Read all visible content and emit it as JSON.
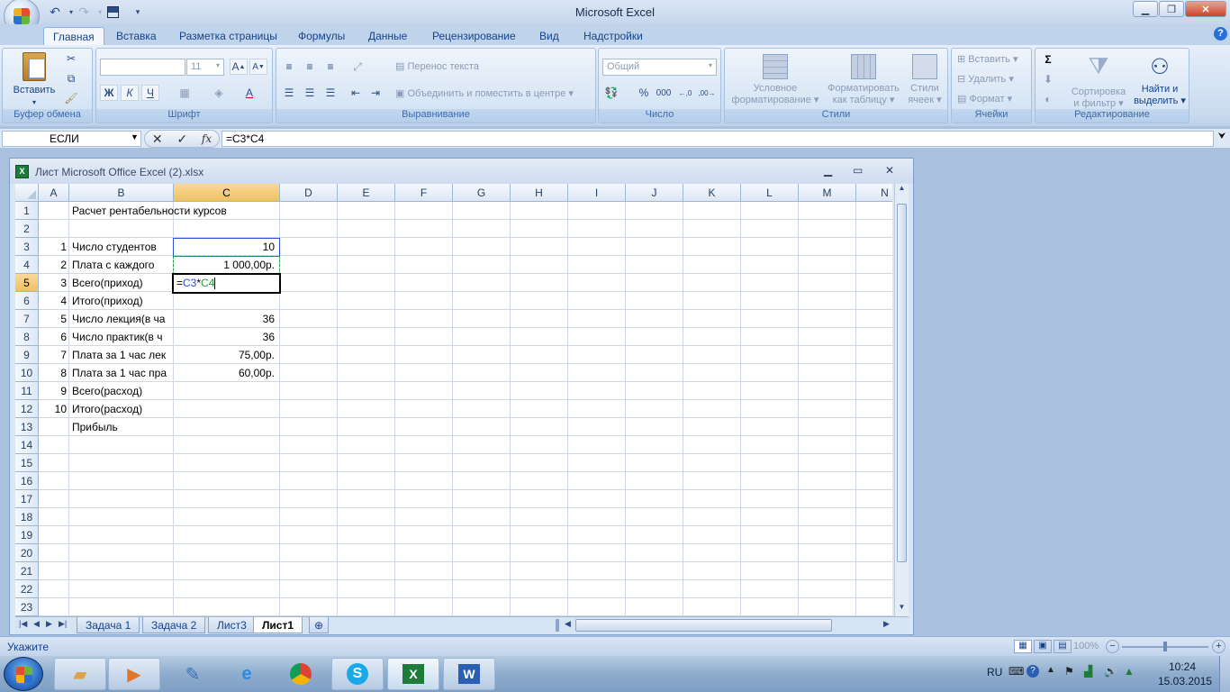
{
  "app": {
    "title": "Microsoft Excel"
  },
  "qat": {
    "save_icon": "save-icon",
    "undo_icon": "undo-icon",
    "redo_icon": "redo-icon"
  },
  "tabs": [
    {
      "label": "Главная",
      "active": true
    },
    {
      "label": "Вставка"
    },
    {
      "label": "Разметка страницы"
    },
    {
      "label": "Формулы"
    },
    {
      "label": "Данные"
    },
    {
      "label": "Рецензирование"
    },
    {
      "label": "Вид"
    },
    {
      "label": "Надстройки"
    }
  ],
  "ribbon": {
    "clipboard": {
      "label": "Буфер обмена",
      "paste": "Вставить"
    },
    "font": {
      "label": "Шрифт",
      "font_size": "11",
      "bold": "Ж",
      "italic": "К",
      "underline": "Ч"
    },
    "alignment": {
      "label": "Выравнивание",
      "wrap": "Перенос текста",
      "merge": "Объединить и поместить в центре"
    },
    "number": {
      "label": "Число",
      "format": "Общий",
      "percent": "%",
      "thousands": "000"
    },
    "styles": {
      "label": "Стили",
      "conditional1": "Условное",
      "conditional2": "форматирование",
      "table1": "Форматировать",
      "table2": "как таблицу",
      "cell1": "Стили",
      "cell2": "ячеек"
    },
    "cells": {
      "label": "Ячейки",
      "insert": "Вставить",
      "delete": "Удалить",
      "format": "Формат"
    },
    "editing": {
      "label": "Редактирование",
      "sort1": "Сортировка",
      "sort2": "и фильтр",
      "find1": "Найти и",
      "find2": "выделить"
    }
  },
  "formula_bar": {
    "name_box": "ЕСЛИ",
    "fx": "fx",
    "formula": "=C3*C4"
  },
  "workbook": {
    "title": "Лист Microsoft Office Excel (2).xlsx",
    "columns": [
      "A",
      "B",
      "C",
      "D",
      "E",
      "F",
      "G",
      "H",
      "I",
      "J",
      "K",
      "L",
      "M",
      "N"
    ],
    "rows": [
      "1",
      "2",
      "3",
      "4",
      "5",
      "6",
      "7",
      "8",
      "9",
      "10",
      "11",
      "12",
      "13",
      "14",
      "15",
      "16",
      "17",
      "18",
      "19",
      "20",
      "21",
      "22",
      "23"
    ],
    "cells": {
      "B1": "Расчет рентабельности курсов",
      "A3": "1",
      "B3": "Число студентов",
      "C3": "10",
      "A4": "2",
      "B4": "Плата с каждого",
      "C4": "1 000,00р.",
      "A5": "3",
      "B5": "Всего(приход)",
      "A6": "4",
      "B6": "Итого(приход)",
      "A7": "5",
      "B7": "Число лекция(в ча",
      "C7": "36",
      "A8": "6",
      "B8": "Число практик(в ч",
      "C8": "36",
      "A9": "7",
      "B9": "Плата за 1 час лек",
      "C9": "75,00р.",
      "A10": "8",
      "B10": "Плата за 1 час пра",
      "C10": "60,00р.",
      "A11": "9",
      "B11": "Всего(расход)",
      "A12": "10",
      "B12": "Итого(расход)",
      "B13": "Прибыль"
    },
    "edit_cell": {
      "eq": "=",
      "ref1": "C3",
      "op": "*",
      "ref2": "C4"
    },
    "sheets": [
      "Задача 1",
      "Задача 2",
      "Лист3",
      "Лист1"
    ],
    "active_sheet": "Лист1"
  },
  "status": {
    "mode": "Укажите",
    "zoom": "100%"
  },
  "taskbar": {
    "lang": "RU",
    "time": "10:24",
    "date": "15.03.2015"
  },
  "colors": {
    "accent": "#15428b",
    "selection": "#f1c15f",
    "ref1": "#2e4fd8",
    "ref2": "#2a9b3a"
  }
}
